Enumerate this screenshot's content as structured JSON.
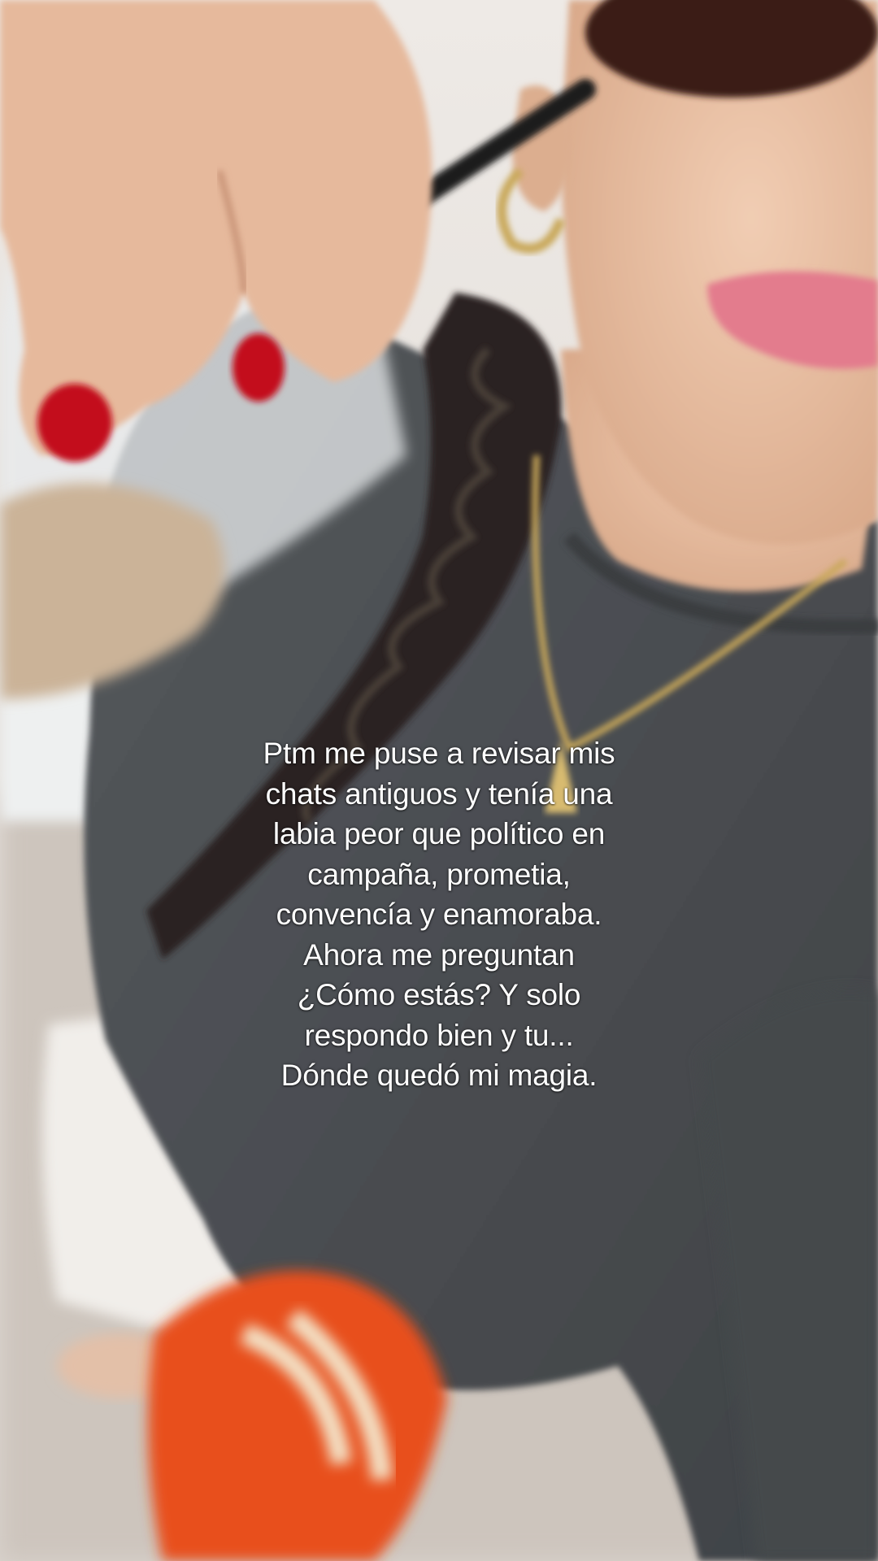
{
  "scene": {
    "description_icon": "photo-scene",
    "colors": {
      "wall": "#e9e6e2",
      "floor": "#cfc7bf",
      "shirt": "#4b4e52",
      "skin": "#e9c2a4",
      "hair": "#2a2420",
      "nails": "#c3111c",
      "lips": "#e0788a",
      "drink": "#cdb59a",
      "scarf": "#e8501f",
      "gold": "#c9a85a"
    }
  },
  "caption": {
    "lines": [
      "Ptm me puse a revisar mis",
      "chats antiguos y tenía una",
      "labia peor que político en",
      "campaña, prometia,",
      "convencía y enamoraba.",
      "Ahora me preguntan",
      "¿Cómo estás? Y solo",
      "respondo bien y tu...",
      "Dónde quedó mi magia."
    ]
  }
}
